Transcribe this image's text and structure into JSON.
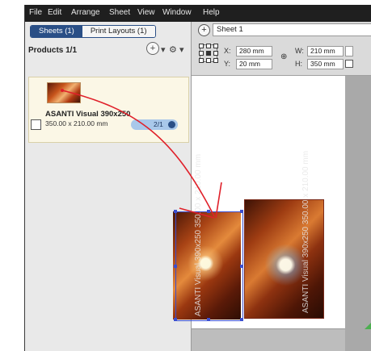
{
  "menu": [
    "File",
    "Edit",
    "Arrange",
    "Sheet",
    "View",
    "Window",
    "Help"
  ],
  "left_panel": {
    "tabs": [
      {
        "label": "Sheets (1)",
        "active": true
      },
      {
        "label": "Print Layouts (1)",
        "active": false
      }
    ],
    "products_title": "Products 1/1",
    "add_icon": "plus-circle-icon",
    "settings_icon": "gear-icon",
    "product": {
      "name": "ASANTI Visual 390x250",
      "size": "350.00 x 210.00 mm",
      "count": "2/1"
    }
  },
  "toolbar": {
    "sheet_name": "Sheet 1",
    "x_label": "X:",
    "x_value": "280 mm",
    "y_label": "Y:",
    "y_value": "20 mm",
    "w_label": "W:",
    "w_value": "210 mm",
    "h_label": "H:",
    "h_value": "350 mm"
  },
  "canvas": {
    "image_caption": "ASANTI Visual 390x250 350.00 x 210.00 mm"
  },
  "colors": {
    "menubar": "#1f1f1f",
    "active_tab": "#2a4f86",
    "product_bg": "#fbf7e6",
    "selection": "#3b4fd0",
    "annotation_arrow": "#e0202a"
  }
}
